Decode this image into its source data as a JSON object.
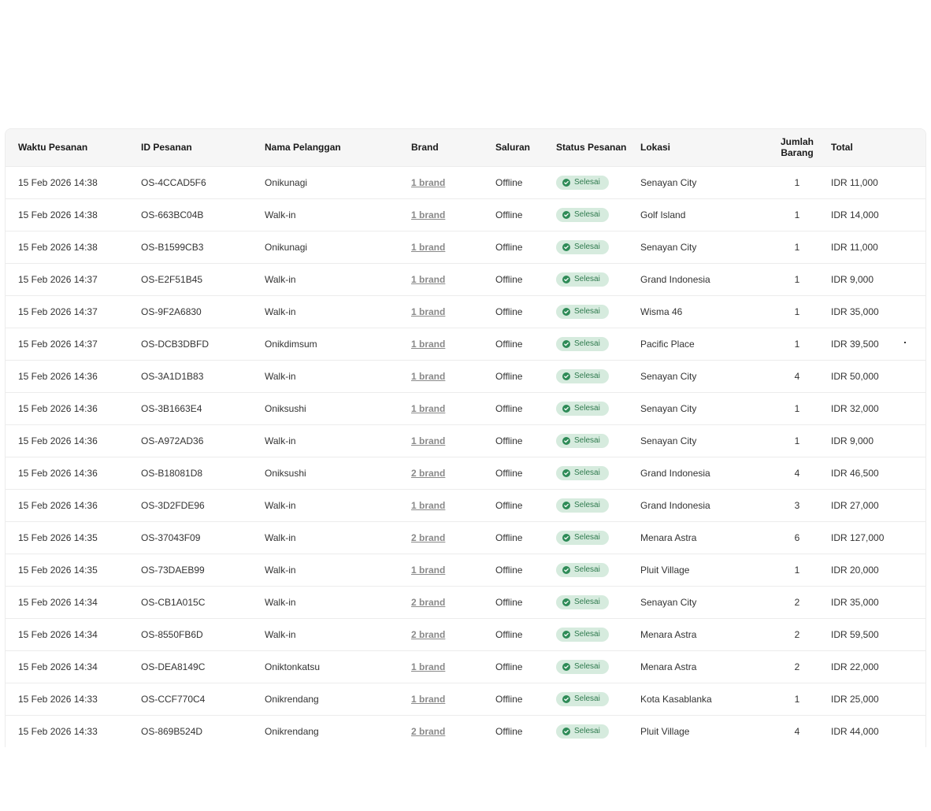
{
  "table": {
    "columns": {
      "waktu": "Waktu Pesanan",
      "id": "ID Pesanan",
      "nama": "Nama Pelanggan",
      "brand": "Brand",
      "saluran": "Saluran",
      "status": "Status Pesanan",
      "lokasi": "Lokasi",
      "jumlah_line1": "Jumlah",
      "jumlah_line2": "Barang",
      "total": "Total"
    },
    "status_color": "#2e8b57",
    "status_bg": "#d6ebde",
    "rows": [
      {
        "waktu": "15 Feb 2026 14:38",
        "id": "OS-4CCAD5F6",
        "nama": "Onikunagi",
        "brand": "1 brand",
        "saluran": "Offline",
        "status": "Selesai",
        "lokasi": "Senayan City",
        "jumlah": "1",
        "total": "IDR 11,000"
      },
      {
        "waktu": "15 Feb 2026 14:38",
        "id": "OS-663BC04B",
        "nama": "Walk-in",
        "brand": "1 brand",
        "saluran": "Offline",
        "status": "Selesai",
        "lokasi": "Golf Island",
        "jumlah": "1",
        "total": "IDR 14,000"
      },
      {
        "waktu": "15 Feb 2026 14:38",
        "id": "OS-B1599CB3",
        "nama": "Onikunagi",
        "brand": "1 brand",
        "saluran": "Offline",
        "status": "Selesai",
        "lokasi": "Senayan City",
        "jumlah": "1",
        "total": "IDR 11,000"
      },
      {
        "waktu": "15 Feb 2026 14:37",
        "id": "OS-E2F51B45",
        "nama": "Walk-in",
        "brand": "1 brand",
        "saluran": "Offline",
        "status": "Selesai",
        "lokasi": "Grand Indonesia",
        "jumlah": "1",
        "total": "IDR 9,000"
      },
      {
        "waktu": "15 Feb 2026 14:37",
        "id": "OS-9F2A6830",
        "nama": "Walk-in",
        "brand": "1 brand",
        "saluran": "Offline",
        "status": "Selesai",
        "lokasi": "Wisma 46",
        "jumlah": "1",
        "total": "IDR 35,000"
      },
      {
        "waktu": "15 Feb 2026 14:37",
        "id": "OS-DCB3DBFD",
        "nama": "Onikdimsum",
        "brand": "1 brand",
        "saluran": "Offline",
        "status": "Selesai",
        "lokasi": "Pacific Place",
        "jumlah": "1",
        "total": "IDR 39,500"
      },
      {
        "waktu": "15 Feb 2026 14:36",
        "id": "OS-3A1D1B83",
        "nama": "Walk-in",
        "brand": "1 brand",
        "saluran": "Offline",
        "status": "Selesai",
        "lokasi": "Senayan City",
        "jumlah": "4",
        "total": "IDR 50,000"
      },
      {
        "waktu": "15 Feb 2026 14:36",
        "id": "OS-3B1663E4",
        "nama": "Oniksushi",
        "brand": "1 brand",
        "saluran": "Offline",
        "status": "Selesai",
        "lokasi": "Senayan City",
        "jumlah": "1",
        "total": "IDR 32,000"
      },
      {
        "waktu": "15 Feb 2026 14:36",
        "id": "OS-A972AD36",
        "nama": "Walk-in",
        "brand": "1 brand",
        "saluran": "Offline",
        "status": "Selesai",
        "lokasi": "Senayan City",
        "jumlah": "1",
        "total": "IDR 9,000"
      },
      {
        "waktu": "15 Feb 2026 14:36",
        "id": "OS-B18081D8",
        "nama": "Oniksushi",
        "brand": "2 brand",
        "saluran": "Offline",
        "status": "Selesai",
        "lokasi": "Grand Indonesia",
        "jumlah": "4",
        "total": "IDR 46,500"
      },
      {
        "waktu": "15 Feb 2026 14:36",
        "id": "OS-3D2FDE96",
        "nama": "Walk-in",
        "brand": "1 brand",
        "saluran": "Offline",
        "status": "Selesai",
        "lokasi": "Grand Indonesia",
        "jumlah": "3",
        "total": "IDR 27,000"
      },
      {
        "waktu": "15 Feb 2026 14:35",
        "id": "OS-37043F09",
        "nama": "Walk-in",
        "brand": "2 brand",
        "saluran": "Offline",
        "status": "Selesai",
        "lokasi": "Menara Astra",
        "jumlah": "6",
        "total": "IDR 127,000"
      },
      {
        "waktu": "15 Feb 2026 14:35",
        "id": "OS-73DAEB99",
        "nama": "Walk-in",
        "brand": "1 brand",
        "saluran": "Offline",
        "status": "Selesai",
        "lokasi": "Pluit Village",
        "jumlah": "1",
        "total": "IDR 20,000"
      },
      {
        "waktu": "15 Feb 2026 14:34",
        "id": "OS-CB1A015C",
        "nama": "Walk-in",
        "brand": "2 brand",
        "saluran": "Offline",
        "status": "Selesai",
        "lokasi": "Senayan City",
        "jumlah": "2",
        "total": "IDR 35,000"
      },
      {
        "waktu": "15 Feb 2026 14:34",
        "id": "OS-8550FB6D",
        "nama": "Walk-in",
        "brand": "2 brand",
        "saluran": "Offline",
        "status": "Selesai",
        "lokasi": "Menara Astra",
        "jumlah": "2",
        "total": "IDR 59,500"
      },
      {
        "waktu": "15 Feb 2026 14:34",
        "id": "OS-DEA8149C",
        "nama": "Oniktonkatsu",
        "brand": "1 brand",
        "saluran": "Offline",
        "status": "Selesai",
        "lokasi": "Menara Astra",
        "jumlah": "2",
        "total": "IDR 22,000"
      },
      {
        "waktu": "15 Feb 2026 14:33",
        "id": "OS-CCF770C4",
        "nama": "Onikrendang",
        "brand": "1 brand",
        "saluran": "Offline",
        "status": "Selesai",
        "lokasi": "Kota Kasablanka",
        "jumlah": "1",
        "total": "IDR 25,000"
      },
      {
        "waktu": "15 Feb 2026 14:33",
        "id": "OS-869B524D",
        "nama": "Onikrendang",
        "brand": "2 brand",
        "saluran": "Offline",
        "status": "Selesai",
        "lokasi": "Pluit Village",
        "jumlah": "4",
        "total": "IDR 44,000"
      }
    ]
  }
}
